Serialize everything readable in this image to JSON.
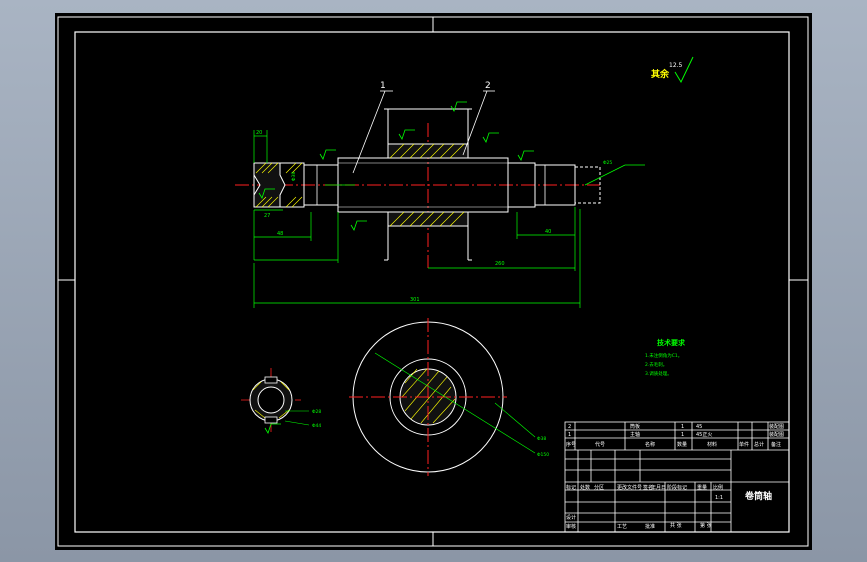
{
  "colors": {
    "background": "#000000",
    "frame": "#ffffff",
    "outline": "#ffffff",
    "dimension": "#00ff00",
    "centerline": "#ff2020",
    "hatch": "#ffff00",
    "leader": "#00ff00",
    "titleblock_text": "#ffffff",
    "notes": "#00ff00"
  },
  "balloons": [
    "1",
    "2"
  ],
  "roughness": {
    "label": "其余",
    "value": "12.5"
  },
  "dimensions": {
    "left_small": "20",
    "left_mid": "48",
    "right_40": "40",
    "right_260": "260",
    "overall": "301",
    "left_27": "27"
  },
  "diameter_labels": [
    "Φ25",
    "Φ38",
    "Φ28",
    "Φ44",
    "Φ150"
  ],
  "tech_notes": {
    "title": "技术要求",
    "items": [
      "1.未注倒角为C1。",
      "2.去毛刺。",
      "3.调质处理。"
    ]
  },
  "title_block": {
    "part_name": "卷筒轴",
    "rows": [
      [
        "2",
        "筒板",
        "1",
        "45"
      ],
      [
        "1",
        "主轴",
        "1",
        "45正火"
      ]
    ],
    "right_labels": [
      "装配图",
      "装配图"
    ],
    "header": [
      "序号",
      "代号",
      "名称",
      "数量",
      "材料",
      "单件",
      "总计",
      "备注"
    ],
    "weight_label": "重量",
    "bottom_labels": [
      "标记",
      "处数",
      "分区",
      "更改文件号",
      "签名",
      "年月日"
    ],
    "design_labels": [
      "设计",
      "审核",
      "工艺",
      "批准"
    ],
    "stage_labels": [
      "阶段标记",
      "重量",
      "比例"
    ],
    "scale": "1:1",
    "sheet_labels": [
      "共 张",
      "第 张"
    ]
  }
}
